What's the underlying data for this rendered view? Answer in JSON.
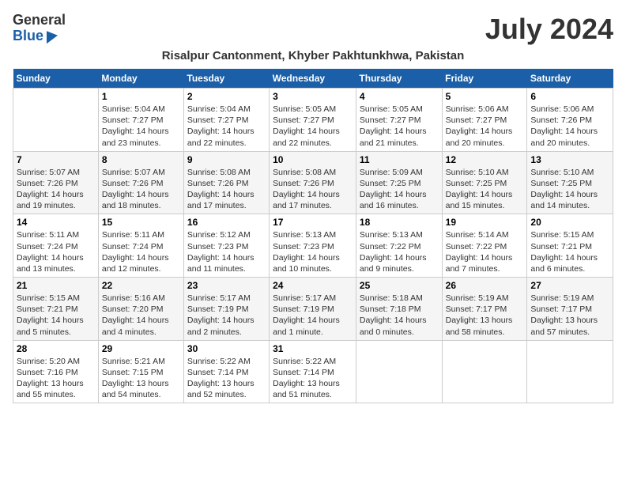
{
  "logo": {
    "general": "General",
    "blue": "Blue"
  },
  "title": "July 2024",
  "location": "Risalpur Cantonment, Khyber Pakhtunkhwa, Pakistan",
  "days_of_week": [
    "Sunday",
    "Monday",
    "Tuesday",
    "Wednesday",
    "Thursday",
    "Friday",
    "Saturday"
  ],
  "weeks": [
    [
      {
        "day": null,
        "content": null
      },
      {
        "day": "1",
        "sunrise": "Sunrise: 5:04 AM",
        "sunset": "Sunset: 7:27 PM",
        "daylight": "Daylight: 14 hours and 23 minutes."
      },
      {
        "day": "2",
        "sunrise": "Sunrise: 5:04 AM",
        "sunset": "Sunset: 7:27 PM",
        "daylight": "Daylight: 14 hours and 22 minutes."
      },
      {
        "day": "3",
        "sunrise": "Sunrise: 5:05 AM",
        "sunset": "Sunset: 7:27 PM",
        "daylight": "Daylight: 14 hours and 22 minutes."
      },
      {
        "day": "4",
        "sunrise": "Sunrise: 5:05 AM",
        "sunset": "Sunset: 7:27 PM",
        "daylight": "Daylight: 14 hours and 21 minutes."
      },
      {
        "day": "5",
        "sunrise": "Sunrise: 5:06 AM",
        "sunset": "Sunset: 7:27 PM",
        "daylight": "Daylight: 14 hours and 20 minutes."
      },
      {
        "day": "6",
        "sunrise": "Sunrise: 5:06 AM",
        "sunset": "Sunset: 7:26 PM",
        "daylight": "Daylight: 14 hours and 20 minutes."
      }
    ],
    [
      {
        "day": "7",
        "sunrise": "Sunrise: 5:07 AM",
        "sunset": "Sunset: 7:26 PM",
        "daylight": "Daylight: 14 hours and 19 minutes."
      },
      {
        "day": "8",
        "sunrise": "Sunrise: 5:07 AM",
        "sunset": "Sunset: 7:26 PM",
        "daylight": "Daylight: 14 hours and 18 minutes."
      },
      {
        "day": "9",
        "sunrise": "Sunrise: 5:08 AM",
        "sunset": "Sunset: 7:26 PM",
        "daylight": "Daylight: 14 hours and 17 minutes."
      },
      {
        "day": "10",
        "sunrise": "Sunrise: 5:08 AM",
        "sunset": "Sunset: 7:26 PM",
        "daylight": "Daylight: 14 hours and 17 minutes."
      },
      {
        "day": "11",
        "sunrise": "Sunrise: 5:09 AM",
        "sunset": "Sunset: 7:25 PM",
        "daylight": "Daylight: 14 hours and 16 minutes."
      },
      {
        "day": "12",
        "sunrise": "Sunrise: 5:10 AM",
        "sunset": "Sunset: 7:25 PM",
        "daylight": "Daylight: 14 hours and 15 minutes."
      },
      {
        "day": "13",
        "sunrise": "Sunrise: 5:10 AM",
        "sunset": "Sunset: 7:25 PM",
        "daylight": "Daylight: 14 hours and 14 minutes."
      }
    ],
    [
      {
        "day": "14",
        "sunrise": "Sunrise: 5:11 AM",
        "sunset": "Sunset: 7:24 PM",
        "daylight": "Daylight: 14 hours and 13 minutes."
      },
      {
        "day": "15",
        "sunrise": "Sunrise: 5:11 AM",
        "sunset": "Sunset: 7:24 PM",
        "daylight": "Daylight: 14 hours and 12 minutes."
      },
      {
        "day": "16",
        "sunrise": "Sunrise: 5:12 AM",
        "sunset": "Sunset: 7:23 PM",
        "daylight": "Daylight: 14 hours and 11 minutes."
      },
      {
        "day": "17",
        "sunrise": "Sunrise: 5:13 AM",
        "sunset": "Sunset: 7:23 PM",
        "daylight": "Daylight: 14 hours and 10 minutes."
      },
      {
        "day": "18",
        "sunrise": "Sunrise: 5:13 AM",
        "sunset": "Sunset: 7:22 PM",
        "daylight": "Daylight: 14 hours and 9 minutes."
      },
      {
        "day": "19",
        "sunrise": "Sunrise: 5:14 AM",
        "sunset": "Sunset: 7:22 PM",
        "daylight": "Daylight: 14 hours and 7 minutes."
      },
      {
        "day": "20",
        "sunrise": "Sunrise: 5:15 AM",
        "sunset": "Sunset: 7:21 PM",
        "daylight": "Daylight: 14 hours and 6 minutes."
      }
    ],
    [
      {
        "day": "21",
        "sunrise": "Sunrise: 5:15 AM",
        "sunset": "Sunset: 7:21 PM",
        "daylight": "Daylight: 14 hours and 5 minutes."
      },
      {
        "day": "22",
        "sunrise": "Sunrise: 5:16 AM",
        "sunset": "Sunset: 7:20 PM",
        "daylight": "Daylight: 14 hours and 4 minutes."
      },
      {
        "day": "23",
        "sunrise": "Sunrise: 5:17 AM",
        "sunset": "Sunset: 7:19 PM",
        "daylight": "Daylight: 14 hours and 2 minutes."
      },
      {
        "day": "24",
        "sunrise": "Sunrise: 5:17 AM",
        "sunset": "Sunset: 7:19 PM",
        "daylight": "Daylight: 14 hours and 1 minute."
      },
      {
        "day": "25",
        "sunrise": "Sunrise: 5:18 AM",
        "sunset": "Sunset: 7:18 PM",
        "daylight": "Daylight: 14 hours and 0 minutes."
      },
      {
        "day": "26",
        "sunrise": "Sunrise: 5:19 AM",
        "sunset": "Sunset: 7:17 PM",
        "daylight": "Daylight: 13 hours and 58 minutes."
      },
      {
        "day": "27",
        "sunrise": "Sunrise: 5:19 AM",
        "sunset": "Sunset: 7:17 PM",
        "daylight": "Daylight: 13 hours and 57 minutes."
      }
    ],
    [
      {
        "day": "28",
        "sunrise": "Sunrise: 5:20 AM",
        "sunset": "Sunset: 7:16 PM",
        "daylight": "Daylight: 13 hours and 55 minutes."
      },
      {
        "day": "29",
        "sunrise": "Sunrise: 5:21 AM",
        "sunset": "Sunset: 7:15 PM",
        "daylight": "Daylight: 13 hours and 54 minutes."
      },
      {
        "day": "30",
        "sunrise": "Sunrise: 5:22 AM",
        "sunset": "Sunset: 7:14 PM",
        "daylight": "Daylight: 13 hours and 52 minutes."
      },
      {
        "day": "31",
        "sunrise": "Sunrise: 5:22 AM",
        "sunset": "Sunset: 7:14 PM",
        "daylight": "Daylight: 13 hours and 51 minutes."
      },
      {
        "day": null,
        "content": null
      },
      {
        "day": null,
        "content": null
      },
      {
        "day": null,
        "content": null
      }
    ]
  ]
}
